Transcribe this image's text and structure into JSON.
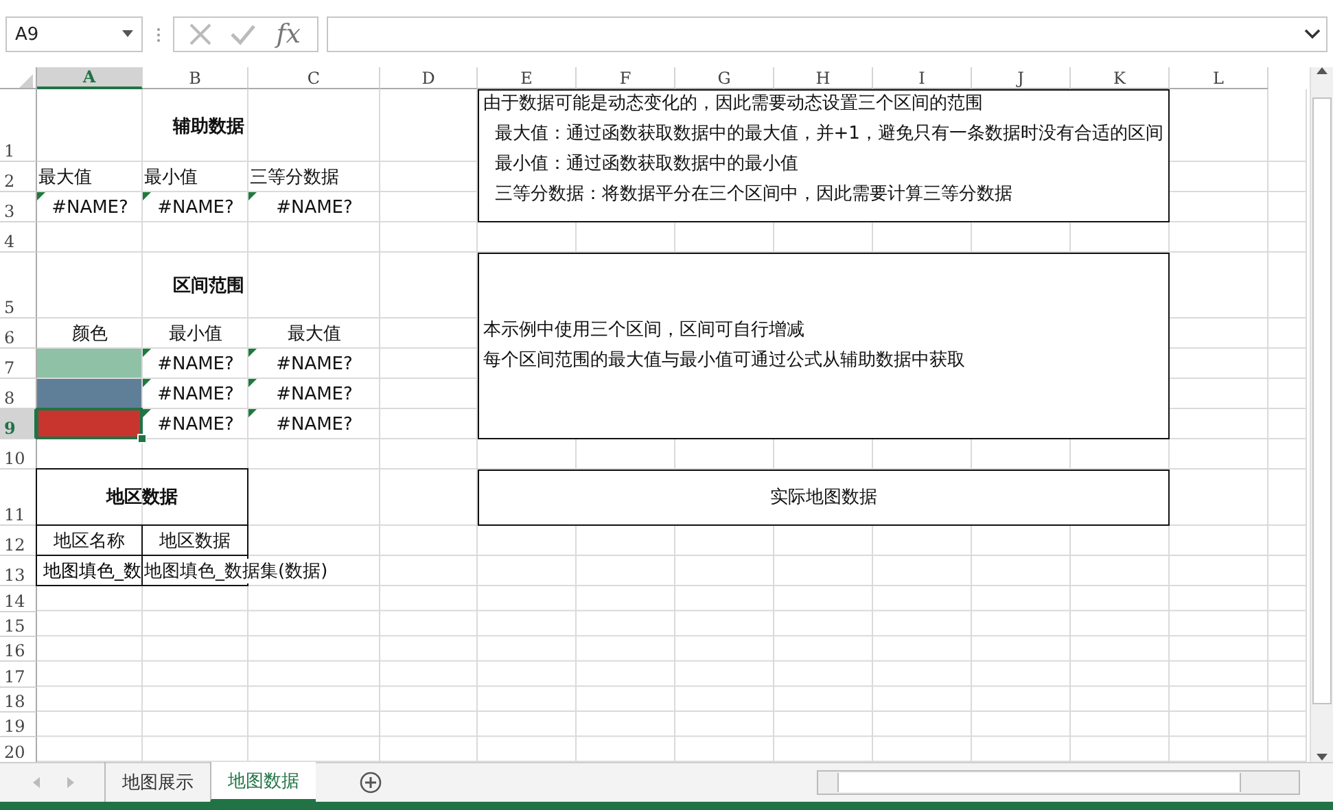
{
  "name_box": "A9",
  "function_button": "fx",
  "columns": [
    {
      "label": "A",
      "selected": true
    },
    {
      "label": "B",
      "selected": false
    },
    {
      "label": "C",
      "selected": false
    },
    {
      "label": "D",
      "selected": false
    },
    {
      "label": "E",
      "selected": false
    },
    {
      "label": "F",
      "selected": false
    },
    {
      "label": "G",
      "selected": false
    },
    {
      "label": "H",
      "selected": false
    },
    {
      "label": "I",
      "selected": false
    },
    {
      "label": "J",
      "selected": false
    },
    {
      "label": "K",
      "selected": false
    },
    {
      "label": "L",
      "selected": false
    }
  ],
  "rows": [
    {
      "label": "1",
      "selected": false
    },
    {
      "label": "2",
      "selected": false
    },
    {
      "label": "3",
      "selected": false
    },
    {
      "label": "4",
      "selected": false
    },
    {
      "label": "5",
      "selected": false
    },
    {
      "label": "6",
      "selected": false
    },
    {
      "label": "7",
      "selected": false
    },
    {
      "label": "8",
      "selected": false
    },
    {
      "label": "9",
      "selected": true
    },
    {
      "label": "10",
      "selected": false
    },
    {
      "label": "11",
      "selected": false
    },
    {
      "label": "12",
      "selected": false
    },
    {
      "label": "13",
      "selected": false
    },
    {
      "label": "14",
      "selected": false
    },
    {
      "label": "15",
      "selected": false
    },
    {
      "label": "16",
      "selected": false
    },
    {
      "label": "17",
      "selected": false
    },
    {
      "label": "18",
      "selected": false
    },
    {
      "label": "19",
      "selected": false
    },
    {
      "label": "20",
      "selected": false
    }
  ],
  "helper": {
    "title": "辅助数据",
    "headers": [
      "最大值",
      "最小值",
      "三等分数据"
    ],
    "values": [
      {
        "text": "#NAME?",
        "flagged": true
      },
      {
        "text": "#NAME?",
        "flagged": true
      },
      {
        "text": "#NAME?",
        "flagged": true
      }
    ]
  },
  "ranges": {
    "title": "区间范围",
    "headers": [
      "颜色",
      "最小值",
      "最大值"
    ],
    "rows": [
      {
        "color": "#8fc1a7",
        "selected": false,
        "min": {
          "text": "#NAME?",
          "flagged": true
        },
        "max": {
          "text": "#NAME?",
          "flagged": true
        }
      },
      {
        "color": "#5f7f99",
        "selected": false,
        "min": {
          "text": "#NAME?",
          "flagged": true
        },
        "max": {
          "text": "#NAME?",
          "flagged": true
        }
      },
      {
        "color": "#c8352f",
        "selected": true,
        "min": {
          "text": "#NAME?",
          "flagged": true
        },
        "max": {
          "text": "#NAME?",
          "flagged": true
        }
      }
    ]
  },
  "region": {
    "title": "地区数据",
    "headers": [
      "地区名称",
      "地区数据"
    ],
    "values": [
      "地图填色_数",
      "地图填色_数据集(数据)"
    ]
  },
  "notes": [
    {
      "kind": "list",
      "lines": [
        "由于数据可能是动态变化的，因此需要动态设置三个区间的范围",
        "  最大值：通过函数获取数据中的最大值，并+1，避免只有一条数据时没有合适的区间",
        "  最小值：通过函数获取数据中的最小值",
        "  三等分数据：将数据平分在三个区间中，因此需要计算三等分数据"
      ]
    },
    {
      "kind": "paragraph",
      "lines": [
        "本示例中使用三个区间，区间可自行增减",
        "每个区间范围的最大值与最小值可通过公式从辅助数据中获取"
      ]
    },
    {
      "kind": "heading",
      "lines": [
        "实际地图数据"
      ]
    }
  ],
  "sheet_tabs": [
    {
      "label": "地图展示",
      "selected": false
    },
    {
      "label": "地图数据",
      "selected": true
    }
  ]
}
